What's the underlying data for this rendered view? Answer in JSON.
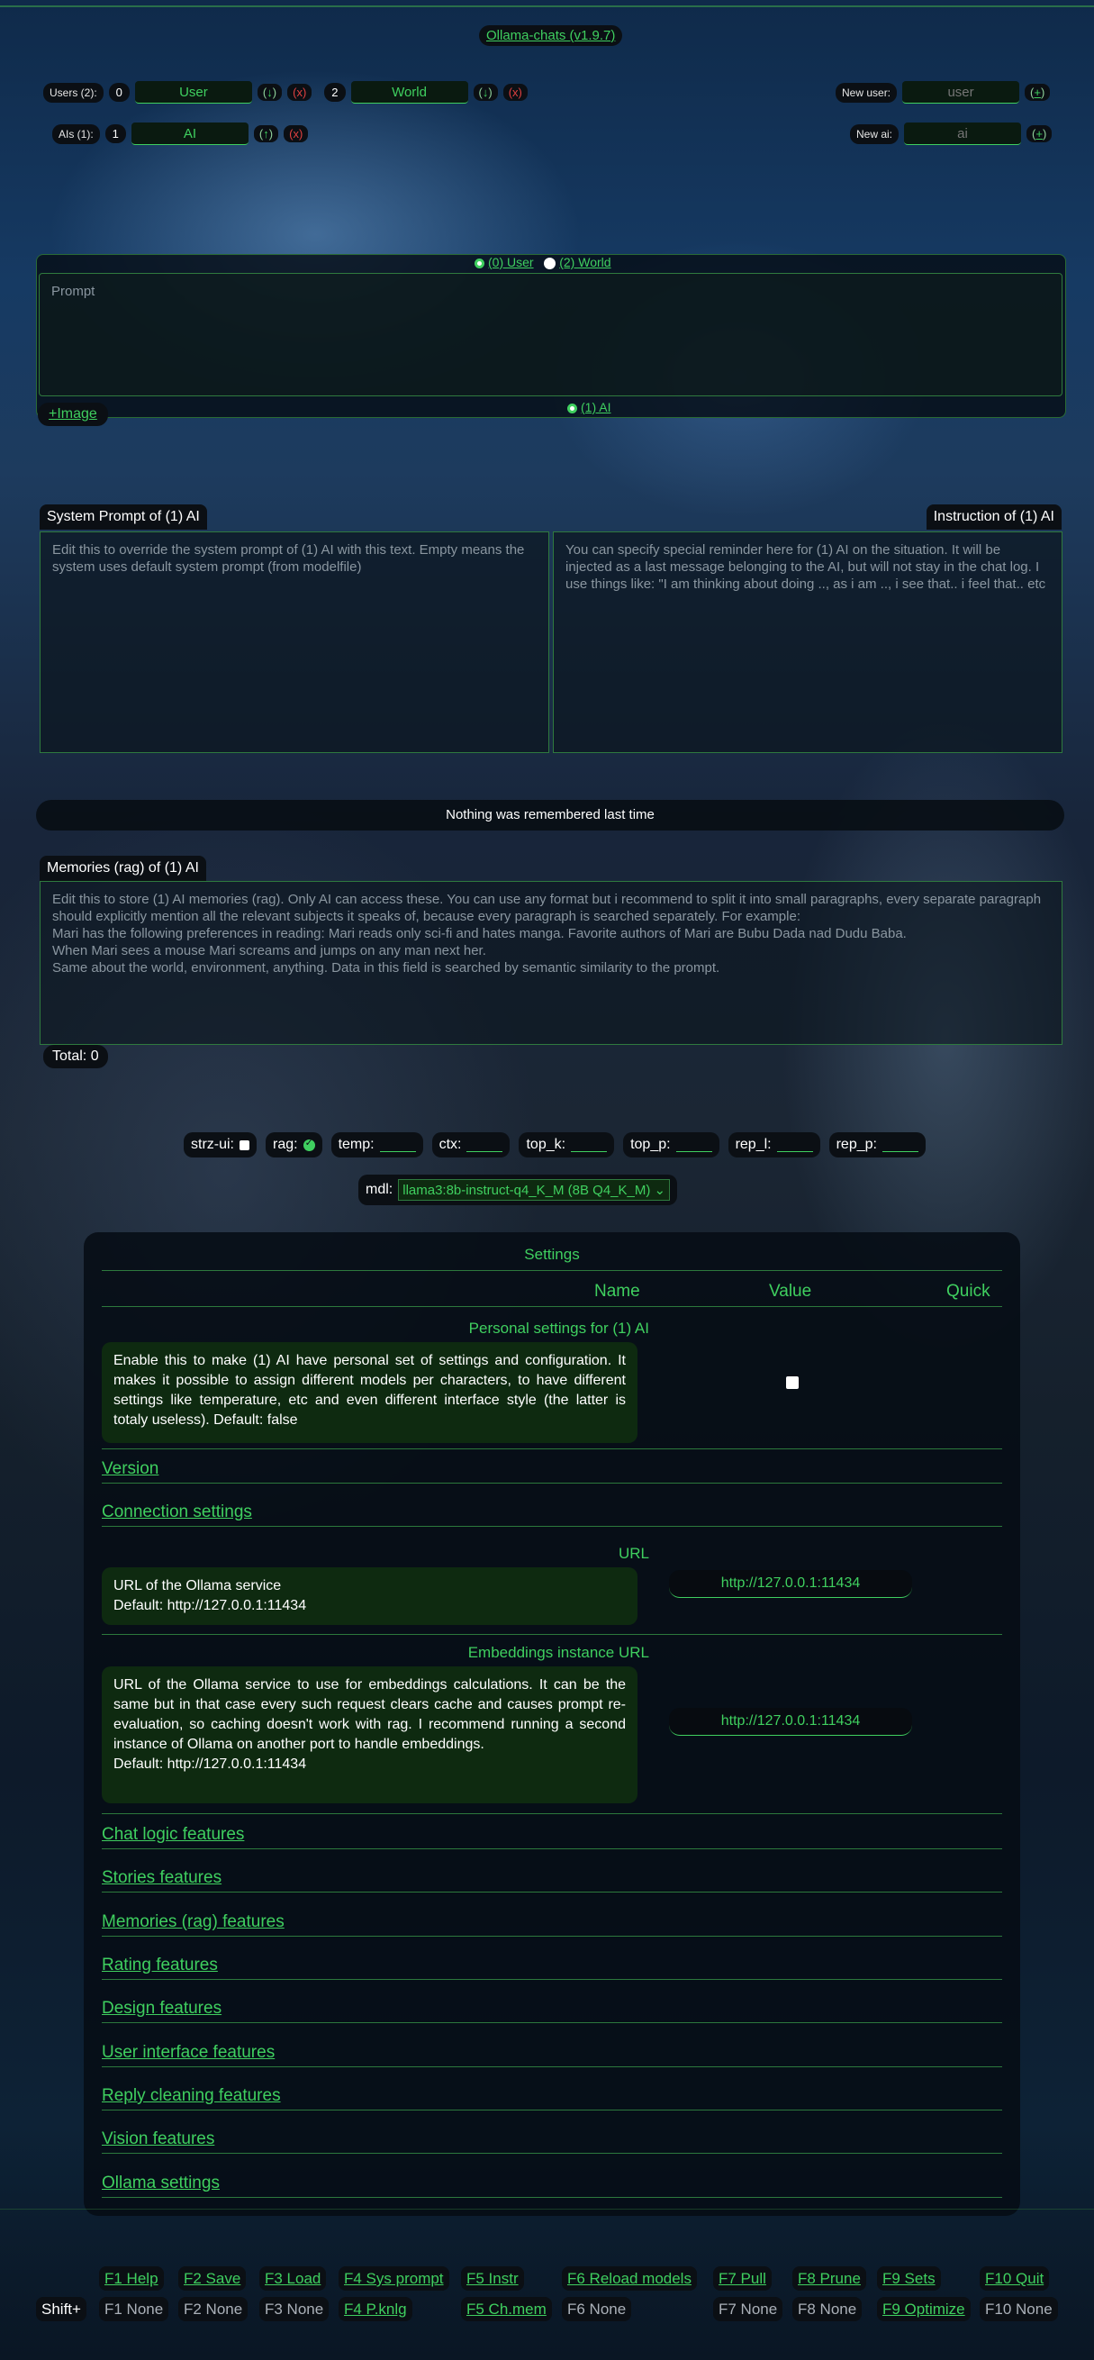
{
  "app": {
    "title": "Ollama-chats (v1.9.7)"
  },
  "users": {
    "label": "Users (2):",
    "items": [
      {
        "num": "0",
        "name": "User",
        "down": "↓",
        "del": "x"
      },
      {
        "num": "2",
        "name": "World",
        "down": "↓",
        "del": "x"
      }
    ],
    "new_label": "New user:",
    "new_placeholder": "user",
    "add": "+"
  },
  "ais": {
    "label": "AIs (1):",
    "items": [
      {
        "num": "1",
        "name": "AI",
        "up": "↑",
        "del": "x"
      }
    ],
    "new_label": "New ai:",
    "new_placeholder": "ai",
    "add": "+"
  },
  "prompt": {
    "targets": [
      "(0) User",
      "(2) World"
    ],
    "placeholder": "Prompt",
    "ai_target": "(1) AI",
    "image_button": "+Image"
  },
  "system_prompt": {
    "title": "System Prompt of (1) AI",
    "placeholder": "Edit this to override the system prompt of (1) AI with this text. Empty means the system uses default system prompt (from modelfile)"
  },
  "instruction": {
    "title": "Instruction of (1) AI",
    "placeholder": "You can specify special reminder here for (1) AI on the situation. It will be injected as a last message belonging to the AI, but will not stay in the chat log. I use things like: \"I am thinking about doing .., as i am .., i see that.. i feel that.. etc"
  },
  "memory_notice": "Nothing was remembered last time",
  "memories": {
    "title": "Memories (rag) of (1) AI",
    "lines": [
      "Edit this to store (1) AI memories (rag). Only AI can access these. You can use any format but i recommend to split it into small paragraphs, every separate paragraph should explicitly mention all the relevant subjects it speaks of, because every paragraph is searched separately. For example:",
      "Mari has the following preferences in reading: Mari reads only sci-fi and hates manga. Favorite authors of Mari are Bubu Dada nad Dudu Baba.",
      "When Mari sees a mouse Mari screams and jumps on any man next her.",
      "Same about the world, environment, anything. Data in this field is searched by semantic similarity to the prompt."
    ],
    "total": "Total: 0"
  },
  "params": {
    "strz_ui": "strz-ui:",
    "rag": "rag:",
    "temp": "temp:",
    "ctx": "ctx:",
    "top_k": "top_k:",
    "top_p": "top_p:",
    "rep_l": "rep_l:",
    "rep_p": "rep_p:",
    "mdl_label": "mdl:",
    "mdl_value": "llama3:8b-instruct-q4_K_M (8B Q4_K_M)"
  },
  "settings": {
    "title": "Settings",
    "col_name": "Name",
    "col_value": "Value",
    "col_quick": "Quick",
    "personal_label": "Personal settings for (1) AI",
    "personal_desc": "Enable this to make (1) AI have personal set of settings and configuration. It makes it possible to assign different models per characters, to have different settings like temperature, etc and even different interface style (the latter is totaly useless). Default: false",
    "version": "Version",
    "connection": "Connection settings",
    "url_label": "URL",
    "url_desc_1": "URL of the Ollama service",
    "url_desc_2": "Default: http://127.0.0.1:11434",
    "url_value": "http://127.0.0.1:11434",
    "emb_label": "Embeddings instance URL",
    "emb_desc_1": "URL of the Ollama service to use for embeddings calculations. It can be the same but in that case every such request clears cache and causes prompt re-evaluation, so caching doesn't work with rag. I recommend running a second instance of Ollama on another port to handle embeddings.",
    "emb_desc_2": "Default: http://127.0.0.1:11434",
    "emb_value": "http://127.0.0.1:11434",
    "sections": [
      "Chat logic features",
      "Stories features",
      "Memories (rag) features",
      "Rating features",
      "Design features",
      "User interface features",
      "Reply cleaning features",
      "Vision features",
      "Ollama settings"
    ]
  },
  "fkeys": {
    "f1": "F1 Help",
    "f2": "F2 Save",
    "f3": "F3 Load",
    "f4": "F4 Sys prompt",
    "f5": "F5 Instr",
    "f6": "F6 Reload models",
    "f7": "F7 Pull",
    "f8": "F8 Prune",
    "f9": "F9 Sets",
    "f10": "F10 Quit",
    "shift": "Shift+",
    "s1": "F1 None",
    "s2": "F2 None",
    "s3": "F3 None",
    "s4": "F4 P.knlg",
    "s5": "F5 Ch.mem",
    "s6": "F6 None",
    "s7": "F7 None",
    "s8": "F8 None",
    "s9": "F9 Optimize",
    "s10": "F10 None"
  },
  "colors": {
    "accent": "#3fcf5f",
    "delete": "#e04040",
    "panel": "#0b0f14"
  }
}
